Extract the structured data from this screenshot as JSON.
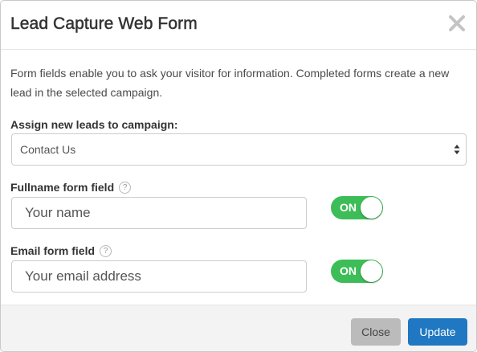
{
  "modal": {
    "title": "Lead Capture Web Form",
    "intro": "Form fields enable you to ask your visitor for information. Completed forms create a new lead in the selected campaign."
  },
  "campaign": {
    "label": "Assign new leads to campaign:",
    "selected": "Contact Us"
  },
  "fields": [
    {
      "label": "Fullname form field",
      "help": "?",
      "placeholder": "Your name",
      "toggle": "ON"
    },
    {
      "label": "Email form field",
      "help": "?",
      "placeholder": "Your email address",
      "toggle": "ON"
    }
  ],
  "footer": {
    "close_label": "Close",
    "update_label": "Update"
  },
  "colors": {
    "toggle_on": "#3dbd58",
    "primary": "#1f78c1",
    "secondary": "#bbbbbb"
  }
}
